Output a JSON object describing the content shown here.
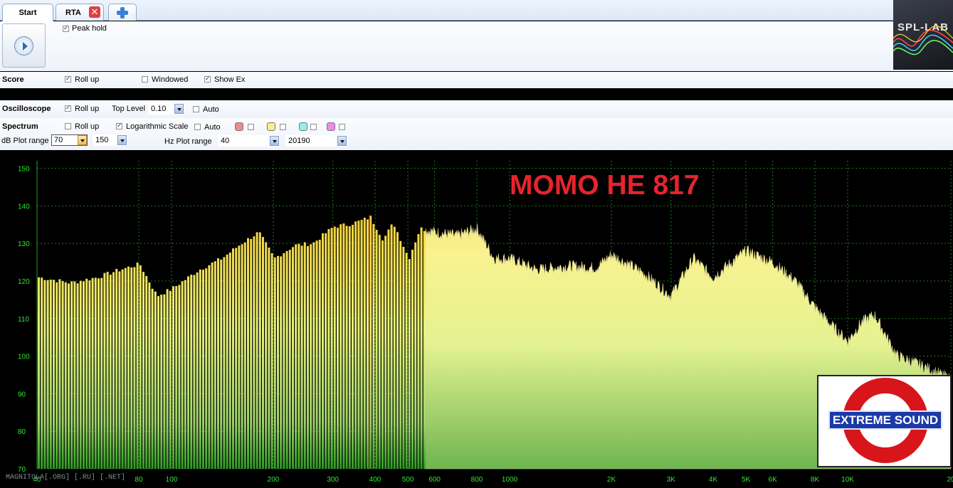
{
  "tabs": [
    {
      "label": "Start"
    },
    {
      "label": "RTA"
    }
  ],
  "top": {
    "peak_hold_label": "Peak hold",
    "peak_hold": true
  },
  "logo": {
    "text": "SPL-LAB"
  },
  "score": {
    "title": "Score",
    "roll_up_label": "Roll up",
    "roll_up": true,
    "windowed_label": "Windowed",
    "windowed": false,
    "show_ex_label": "Show Ex",
    "show_ex": true
  },
  "oscilloscope": {
    "title": "Oscilloscope",
    "roll_up_label": "Roll up",
    "roll_up": true,
    "top_level_label": "Top Level",
    "top_level": "0.10",
    "auto_label": "Auto",
    "auto": false
  },
  "spectrum": {
    "title": "Spectrum",
    "roll_up_label": "Roll up",
    "roll_up": false,
    "log_scale_label": "Logarithmic Scale",
    "log_scale": true,
    "auto_label": "Auto",
    "auto": false,
    "colors": [
      "#f08a8a",
      "#f7f08a",
      "#8ff0f0",
      "#f08af0"
    ],
    "db_range_label": "dB Plot range",
    "db_min": "70",
    "db_max": "150",
    "hz_range_label": "Hz Plot range",
    "hz_min": "40",
    "hz_max": "20190"
  },
  "chart_data": {
    "type": "bar",
    "title": "MOMO HE 817",
    "xscale": "log",
    "xlim": [
      40,
      20190
    ],
    "ylim": [
      70,
      152
    ],
    "y_ticks": [
      "150",
      "140",
      "130",
      "120",
      "110",
      "100",
      "90",
      "80",
      "70"
    ],
    "x_ticks": [
      "40",
      "80",
      "100",
      "200",
      "300",
      "400",
      "500",
      "600",
      "800",
      "1000",
      "2K",
      "3K",
      "4K",
      "5K",
      "6K",
      "8K",
      "10K",
      "20"
    ],
    "grid": true,
    "peak_hz": 385,
    "x": [
      40,
      50,
      60,
      70,
      80,
      90,
      100,
      120,
      140,
      160,
      180,
      200,
      230,
      260,
      300,
      330,
      360,
      385,
      420,
      450,
      500,
      540,
      600,
      700,
      800,
      900,
      1000,
      1200,
      1500,
      1800,
      2000,
      2500,
      3000,
      3500,
      4000,
      5000,
      6000,
      7000,
      8000,
      9000,
      10000,
      11000,
      12000,
      14000,
      16000,
      18000,
      20000
    ],
    "y": [
      121,
      119.5,
      121,
      123,
      124.5,
      116,
      118,
      123,
      126,
      130,
      133,
      126,
      129.5,
      130,
      134.5,
      135,
      136,
      137,
      131,
      135.5,
      126,
      134,
      133,
      132,
      134,
      126,
      126,
      123,
      124,
      123.5,
      127,
      122,
      116,
      126,
      121,
      128,
      125,
      120,
      113,
      108,
      104,
      109,
      111,
      100,
      98,
      96,
      94
    ]
  },
  "footer": {
    "text": "MAGNITOLA[.ORG] [.RU] [.NET]"
  },
  "badge": {
    "text": "EXTREME SOUND"
  }
}
